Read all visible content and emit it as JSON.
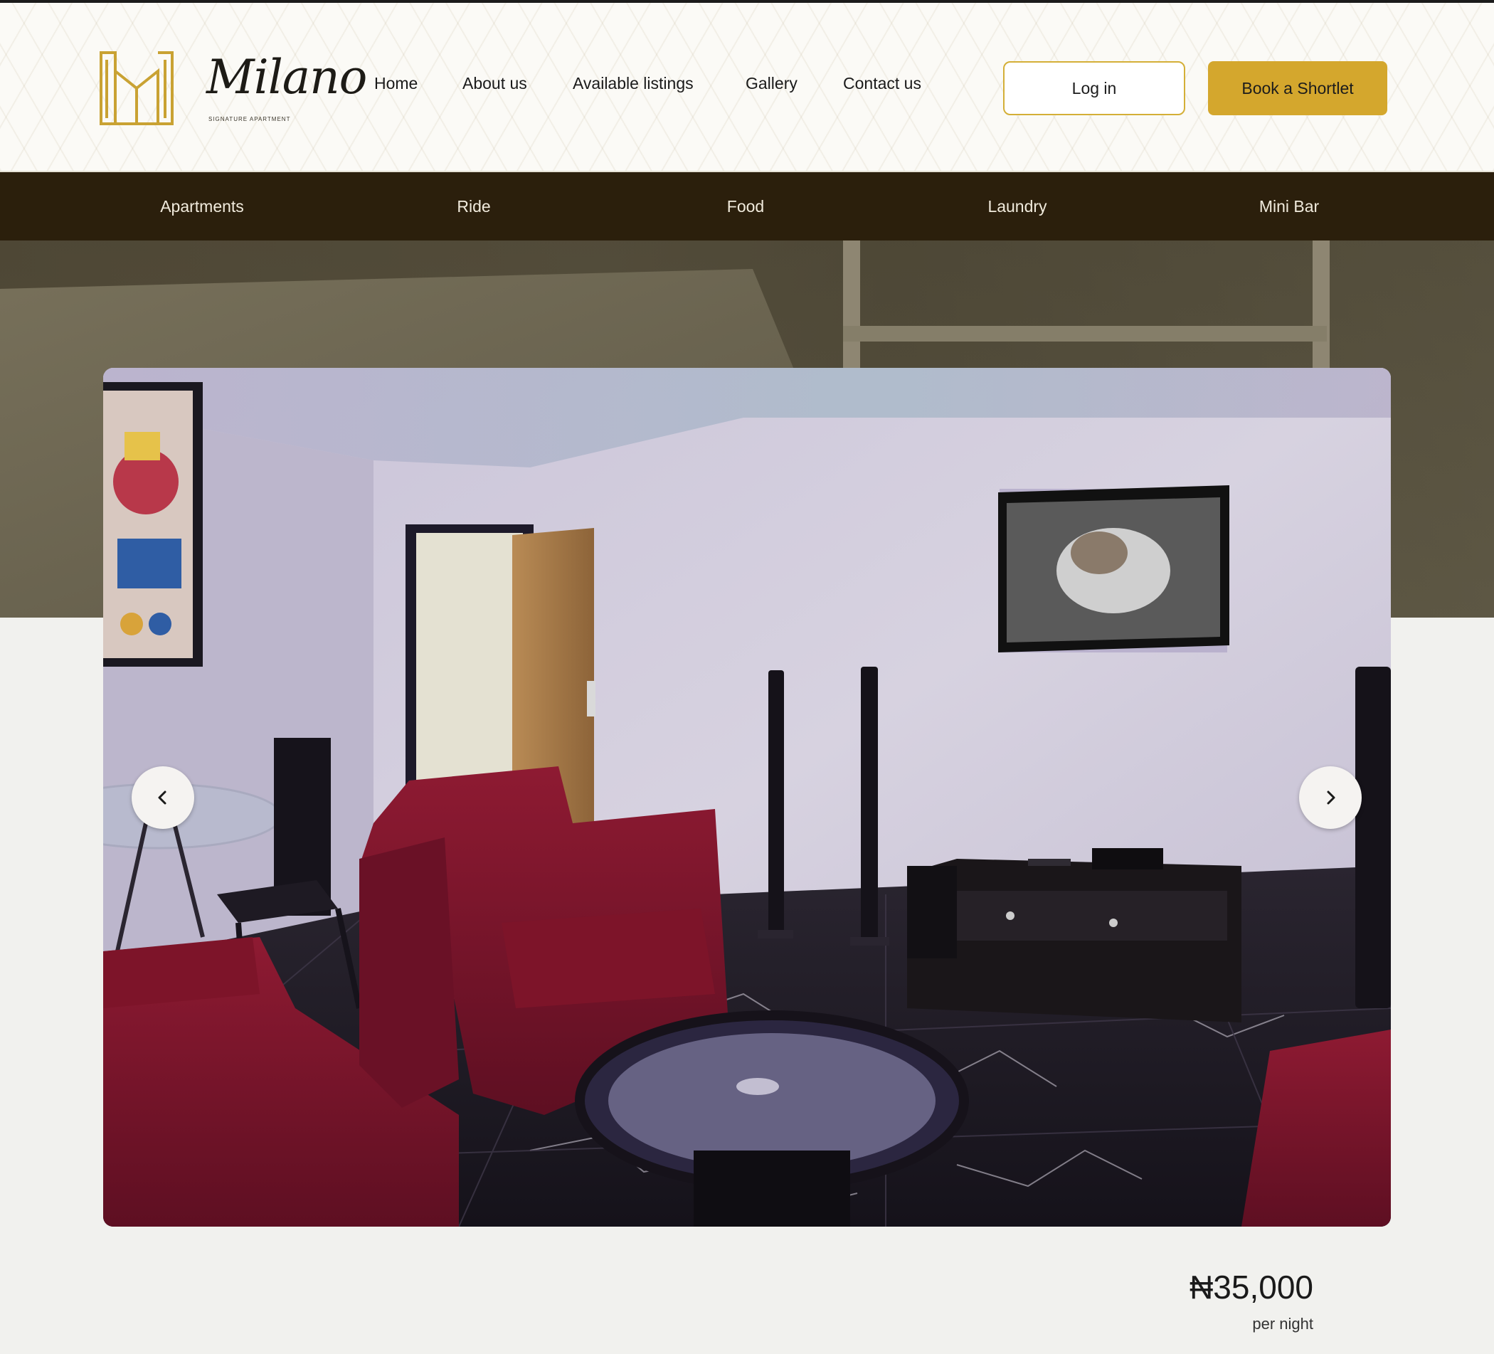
{
  "brand": {
    "name": "Milano",
    "tagline": "SIGNATURE APARTMENT",
    "colors": {
      "gold": "#d4a72d",
      "dark_brown": "#2b1f0c"
    }
  },
  "nav": {
    "items": [
      {
        "label": "Home"
      },
      {
        "label": "About us"
      },
      {
        "label": "Available listings"
      },
      {
        "label": "Gallery"
      },
      {
        "label": "Contact us"
      }
    ],
    "login_label": "Log in",
    "book_label": "Book a Shortlet"
  },
  "subnav": {
    "items": [
      {
        "label": "Apartments"
      },
      {
        "label": "Ride"
      },
      {
        "label": "Food"
      },
      {
        "label": "Laundry"
      },
      {
        "label": "Mini Bar"
      }
    ]
  },
  "slider": {
    "image_description": "Living room with red armchairs, glass coffee table, wall-mounted TV, tower speakers and black marble floor",
    "prev_icon": "chevron-left-icon",
    "next_icon": "chevron-right-icon"
  },
  "pricing": {
    "price": "₦35,000",
    "unit": "per night"
  }
}
